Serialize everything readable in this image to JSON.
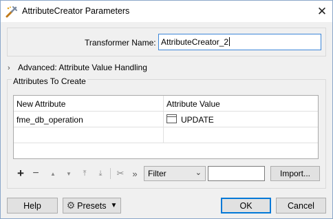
{
  "window": {
    "title": "AttributeCreator Parameters",
    "close_glyph": "✕",
    "icon": "transformer-icon"
  },
  "transformer_name": {
    "label": "Transformer Name:",
    "value": "AttributeCreator_2"
  },
  "advanced": {
    "chevron": "›",
    "label": "Advanced: Attribute Value Handling"
  },
  "attributes_group": {
    "label": "Attributes To Create",
    "columns": [
      "New Attribute",
      "Attribute Value"
    ],
    "rows": [
      {
        "attribute": "fme_db_operation",
        "value": "UPDATE",
        "value_icon": "text-editor-icon"
      }
    ]
  },
  "toolbar": {
    "icons": [
      {
        "name": "add-icon",
        "glyph": "+"
      },
      {
        "name": "remove-icon",
        "glyph": "−"
      },
      {
        "name": "move-up-icon",
        "glyph": "▲"
      },
      {
        "name": "move-down-icon",
        "glyph": "▼"
      },
      {
        "name": "move-top-icon",
        "glyph": "⤒"
      },
      {
        "name": "move-bottom-icon",
        "glyph": "⤓"
      },
      {
        "name": "cut-icon",
        "glyph": "✂"
      },
      {
        "name": "more-icon",
        "glyph": "»"
      }
    ],
    "filter_selected": "Filter",
    "filter_chevron": "⌄",
    "import_label": "Import..."
  },
  "buttons": {
    "help": "Help",
    "presets": "Presets",
    "presets_caret": "▼",
    "presets_icon": "gear-icon",
    "ok": "OK",
    "cancel": "Cancel"
  },
  "colors": {
    "focus_blue": "#0078d7",
    "input_border_focus": "#3b86d8",
    "window_bg": "#f0f0f0"
  }
}
